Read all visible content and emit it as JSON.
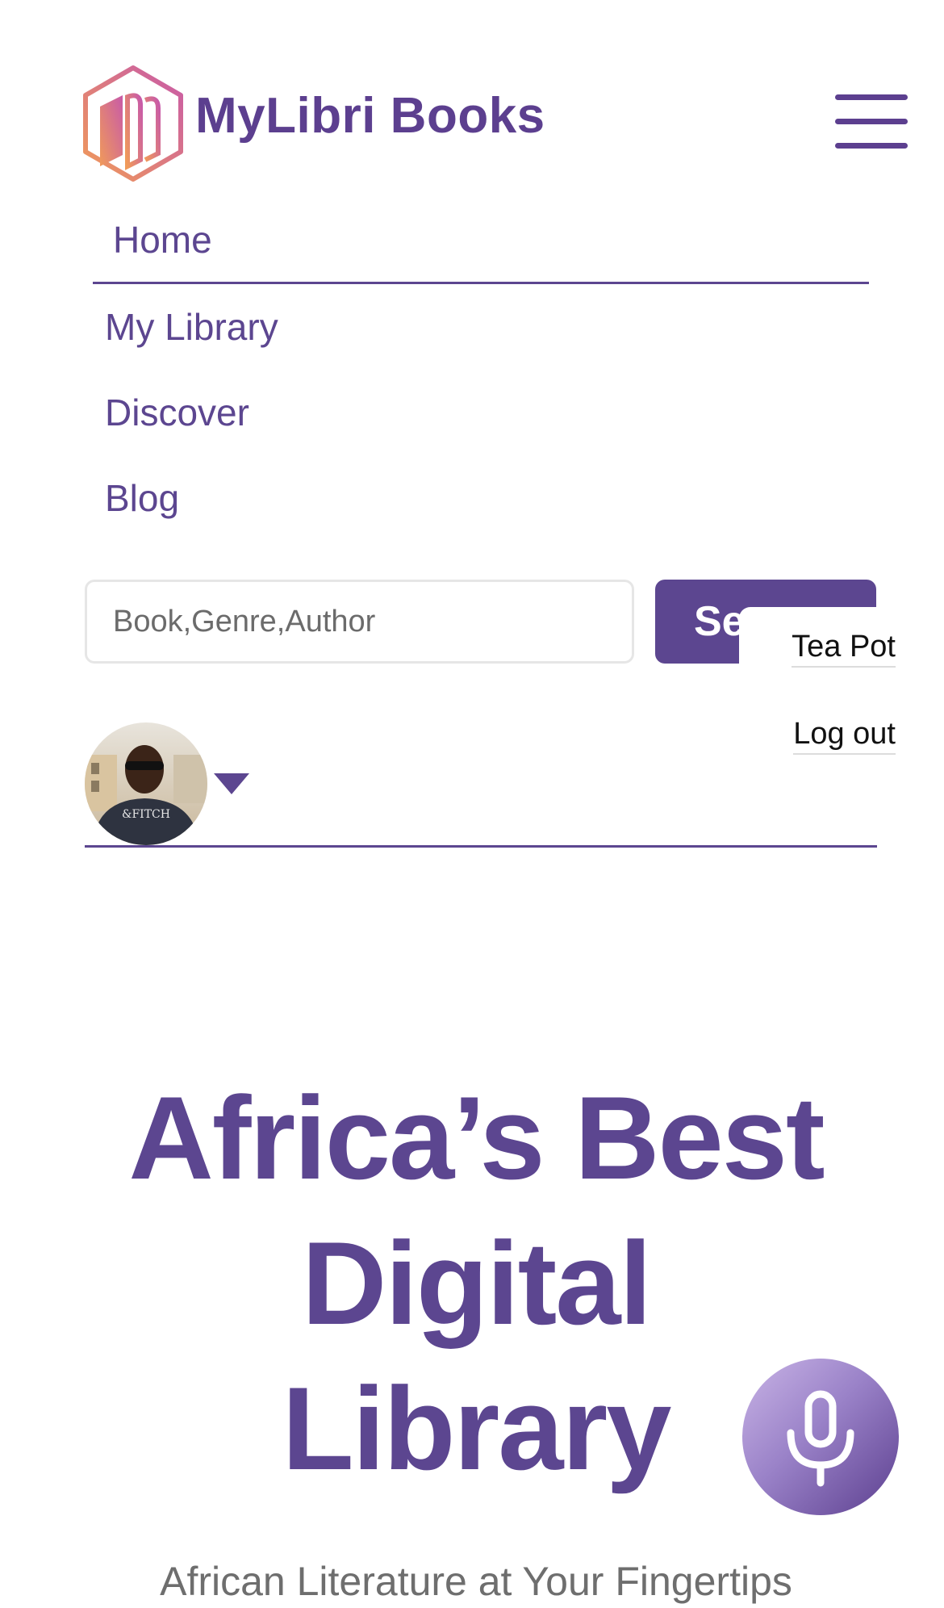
{
  "header": {
    "brand_name": "MyLibri Books",
    "logo_icon": "book-hexagon-logo",
    "menu_icon": "hamburger-menu-icon"
  },
  "nav": {
    "items": [
      {
        "label": "Home"
      },
      {
        "label": "My Library"
      },
      {
        "label": "Discover"
      },
      {
        "label": "Blog"
      }
    ]
  },
  "search": {
    "placeholder": "Book,Genre,Author",
    "value": "",
    "button_label": "Se"
  },
  "profile_menu": {
    "items": [
      {
        "label": "Tea Pot"
      },
      {
        "label": "Log out"
      }
    ],
    "caret_icon": "caret-down-icon"
  },
  "hero": {
    "title_lines": [
      "Africa’s Best",
      "Digital",
      "Library"
    ],
    "subtitle": "African Literature at Your Fingertips"
  },
  "mic": {
    "icon": "microphone-icon"
  },
  "colors": {
    "brand_purple": "#5c4690",
    "logo_gradient_start": "#e98a5c",
    "logo_gradient_end": "#c95aa8",
    "subtitle_gray": "#6e6e6e"
  }
}
